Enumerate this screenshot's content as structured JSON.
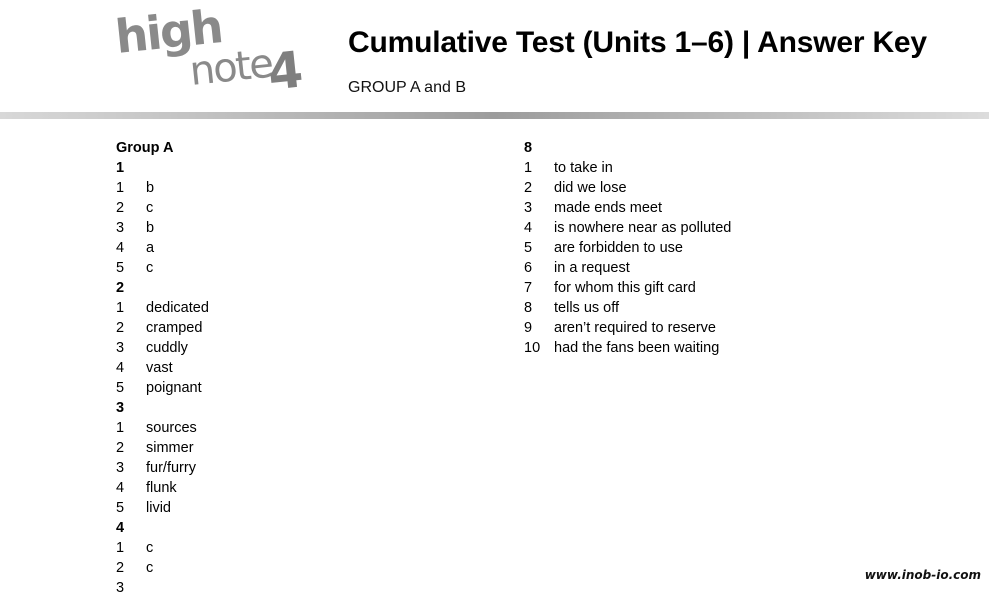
{
  "header": {
    "logo": {
      "line1": "high",
      "line2": "note",
      "level": "4"
    },
    "title": "Cumulative Test (Units 1–6) | Answer Key",
    "subtitle": "GROUP A and B"
  },
  "left_column": {
    "group_title": "Group A",
    "sections": [
      {
        "number": "1",
        "answers": [
          {
            "n": "1",
            "a": "b"
          },
          {
            "n": "2",
            "a": "c"
          },
          {
            "n": "3",
            "a": "b"
          },
          {
            "n": "4",
            "a": "a"
          },
          {
            "n": "5",
            "a": "c"
          }
        ]
      },
      {
        "number": "2",
        "answers": [
          {
            "n": "1",
            "a": "dedicated"
          },
          {
            "n": "2",
            "a": "cramped"
          },
          {
            "n": "3",
            "a": "cuddly"
          },
          {
            "n": "4",
            "a": "vast"
          },
          {
            "n": "5",
            "a": "poignant"
          }
        ]
      },
      {
        "number": "3",
        "answers": [
          {
            "n": "1",
            "a": "sources"
          },
          {
            "n": "2",
            "a": "simmer"
          },
          {
            "n": "3",
            "a": "fur/furry"
          },
          {
            "n": "4",
            "a": "flunk"
          },
          {
            "n": "5",
            "a": "livid"
          }
        ]
      },
      {
        "number": "4",
        "answers": [
          {
            "n": "1",
            "a": "c"
          },
          {
            "n": "2",
            "a": "c"
          },
          {
            "n": "3",
            "a": ""
          }
        ]
      }
    ]
  },
  "right_column": {
    "sections": [
      {
        "number": "8",
        "answers": [
          {
            "n": "1",
            "a": "to take in"
          },
          {
            "n": "2",
            "a": "did we lose"
          },
          {
            "n": "3",
            "a": "made ends meet"
          },
          {
            "n": "4",
            "a": "is nowhere near as polluted"
          },
          {
            "n": "5",
            "a": "are forbidden to use"
          },
          {
            "n": "6",
            "a": "in a request"
          },
          {
            "n": "7",
            "a": "for whom this gift card"
          },
          {
            "n": "8",
            "a": "tells us off"
          },
          {
            "n": "9",
            "a": "aren’t required to reserve"
          },
          {
            "n": "10",
            "a": "had the fans been waiting"
          }
        ]
      }
    ]
  },
  "footer": {
    "watermark": "www.inob-io.com"
  }
}
